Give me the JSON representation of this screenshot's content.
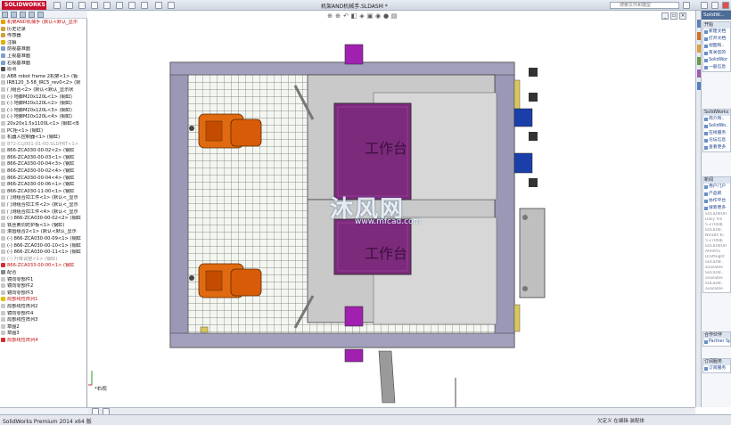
{
  "app": {
    "logo_text": "SOLIDWORKS",
    "document_title": "机架AND机械手.SLDASM *",
    "search_placeholder": "搜索文件和模型",
    "status_left": "SolidWorks Premium 2014 x64 版",
    "status_right": "欠定义  在编辑 装配体",
    "triad_label": "*右视"
  },
  "feature_tree": {
    "items": [
      {
        "label": "机架AND机械手 (默认<默认_显示",
        "color": "#e8a000",
        "style": "red"
      },
      {
        "label": "历史记录",
        "color": "#d0a040",
        "style": ""
      },
      {
        "label": "传感器",
        "color": "#d0a040",
        "style": ""
      },
      {
        "label": "注解",
        "color": "#e0b000",
        "style": ""
      },
      {
        "label": "前视基准面",
        "color": "#7da0d0",
        "style": ""
      },
      {
        "label": "上视基准面",
        "color": "#7da0d0",
        "style": ""
      },
      {
        "label": "右视基准面",
        "color": "#7da0d0",
        "style": ""
      },
      {
        "label": "原点",
        "color": "#555555",
        "style": ""
      },
      {
        "label": "ABB robot frame 2机架<1> (钣",
        "color": "#c8c8c8",
        "style": ""
      },
      {
        "label": "IRB120_3-58_IRC5_rev0<2> (默",
        "color": "#c8c8c8",
        "style": ""
      },
      {
        "label": "门组合<2> (默认<默认_显示状",
        "color": "#c8c8c8",
        "style": ""
      },
      {
        "label": "(-) 地脚M20x120L<1> (钢缸)",
        "color": "#c8c8c8",
        "style": ""
      },
      {
        "label": "(-) 地脚M20x120L<2> (钢缸)",
        "color": "#c8c8c8",
        "style": ""
      },
      {
        "label": "(-) 地脚M20x120L<3> (钢缸)",
        "color": "#c8c8c8",
        "style": ""
      },
      {
        "label": "(-) 地脚M20x120L<4> (钢缸)",
        "color": "#c8c8c8",
        "style": ""
      },
      {
        "label": "20x20x1.5x1100L<1> (钢缸<B",
        "color": "#c8c8c8",
        "style": ""
      },
      {
        "label": "PC柜<1> (钢缸)",
        "color": "#c8c8c8",
        "style": ""
      },
      {
        "label": "机器人控制器<1> (钢缸)",
        "color": "#c8c8c8",
        "style": ""
      },
      {
        "label": "872-CLJ001-01-00.SLDPRT<1>",
        "color": "#d8d8d8",
        "style": "gray"
      },
      {
        "label": "866-ZCA030-00-02<2> (钢缸",
        "color": "#c8c8c8",
        "style": ""
      },
      {
        "label": "866-ZCA030-00-03<1> (钢缸",
        "color": "#c8c8c8",
        "style": ""
      },
      {
        "label": "866-ZCA030-00-04<3> (钢缸",
        "color": "#c8c8c8",
        "style": ""
      },
      {
        "label": "866-ZCA030-00-02<4> (钢缸",
        "color": "#c8c8c8",
        "style": ""
      },
      {
        "label": "866-ZCA030-00-04<4> (钢缸",
        "color": "#c8c8c8",
        "style": ""
      },
      {
        "label": "866-ZCA030-00-06<1> (钢缸",
        "color": "#c8c8c8",
        "style": ""
      },
      {
        "label": "866-ZCA030-11-00<1> (钢缸",
        "color": "#c8c8c8",
        "style": ""
      },
      {
        "label": "门测组合扣工件<1> (默认<_显示",
        "color": "#c8c8c8",
        "style": ""
      },
      {
        "label": "门测组合扣工件<2> (默认<_显示",
        "color": "#c8c8c8",
        "style": ""
      },
      {
        "label": "门测组合扣工件<4> (默认<_显示",
        "color": "#c8c8c8",
        "style": ""
      },
      {
        "label": "(-) 866-ZCA030-00-02<2> (钢缸",
        "color": "#c8c8c8",
        "style": ""
      },
      {
        "label": "铁丝黄同防护板<1> (钢缸)",
        "color": "#c8c8c8",
        "style": ""
      },
      {
        "label": "滚齿组合2<1> (默认<默认_显示",
        "color": "#c8c8c8",
        "style": ""
      },
      {
        "label": "(-) 866-ZCA030-00-09<1> (钢缸",
        "color": "#c8c8c8",
        "style": ""
      },
      {
        "label": "(-) 866-ZCA030-00-10<1> (钢缸",
        "color": "#c8c8c8",
        "style": ""
      },
      {
        "label": "(-) 866-ZCA030-00-11<1> (钢缸",
        "color": "#c8c8c8",
        "style": ""
      },
      {
        "label": "(-) 升降调整<1> (钢缸)",
        "color": "#d8d8d8",
        "style": "gray"
      },
      {
        "label": "866-ZCA033-00-00<1> (钢缸",
        "color": "#d03030",
        "style": "red"
      },
      {
        "label": "配合",
        "color": "#888888",
        "style": ""
      },
      {
        "label": "镜向零部件1",
        "color": "#c8c8c8",
        "style": ""
      },
      {
        "label": "镜向零部件2",
        "color": "#c8c8c8",
        "style": ""
      },
      {
        "label": "镜向零部件3",
        "color": "#c8c8c8",
        "style": ""
      },
      {
        "label": "局部线性阵列1",
        "color": "#e0c000",
        "style": "red"
      },
      {
        "label": "局部线性阵列2",
        "color": "#c8c8c8",
        "style": ""
      },
      {
        "label": "镜向零部件4",
        "color": "#c8c8c8",
        "style": ""
      },
      {
        "label": "局部线性阵列3",
        "color": "#c8c8c8",
        "style": ""
      },
      {
        "label": "草图2",
        "color": "#c8c8c8",
        "style": ""
      },
      {
        "label": "草图3",
        "color": "#c8c8c8",
        "style": ""
      },
      {
        "label": "局部线性阵列4",
        "color": "#d03030",
        "style": "red"
      }
    ]
  },
  "task_pane": {
    "header": "SolidW...",
    "sec1_title": "开始",
    "sec1_links": [
      "新建文档",
      "打开文档",
      "视图和..",
      "有关您的",
      "SolidWor",
      "一般信息"
    ],
    "sec2_title": "SolidWorks",
    "sec2_links": [
      "简介和..",
      "SolidWo..",
      "在线服务",
      "论坛信息",
      "查看更多"
    ],
    "sec3_title": "新闻",
    "sec3_links": [
      "用户门户",
      "产品新",
      "协作平台",
      "搜索更多"
    ],
    "sec3_gray": [
      "SOLIDWOR",
      "Daily Vie",
      "5-2700系",
      "SOLIDW..",
      "NVIDIA Ki",
      "5-2700系",
      "SOLIDWOR",
      "ARRAYS",
      "Draftsight",
      "SOLIDW..",
      "available",
      "SOLIDW..",
      "available",
      "SOLIDW..",
      "available"
    ],
    "sec4_title": "合作伙伴",
    "sec4_links": [
      "Partner Sp"
    ],
    "sec5_title": "订阅服务",
    "sec5_links": [
      "订阅服务"
    ]
  },
  "watermark": {
    "main": "沐风网",
    "sub": "www.mfcad.com"
  },
  "model": {
    "label_upper": "工作台",
    "label_lower": "工作台"
  }
}
